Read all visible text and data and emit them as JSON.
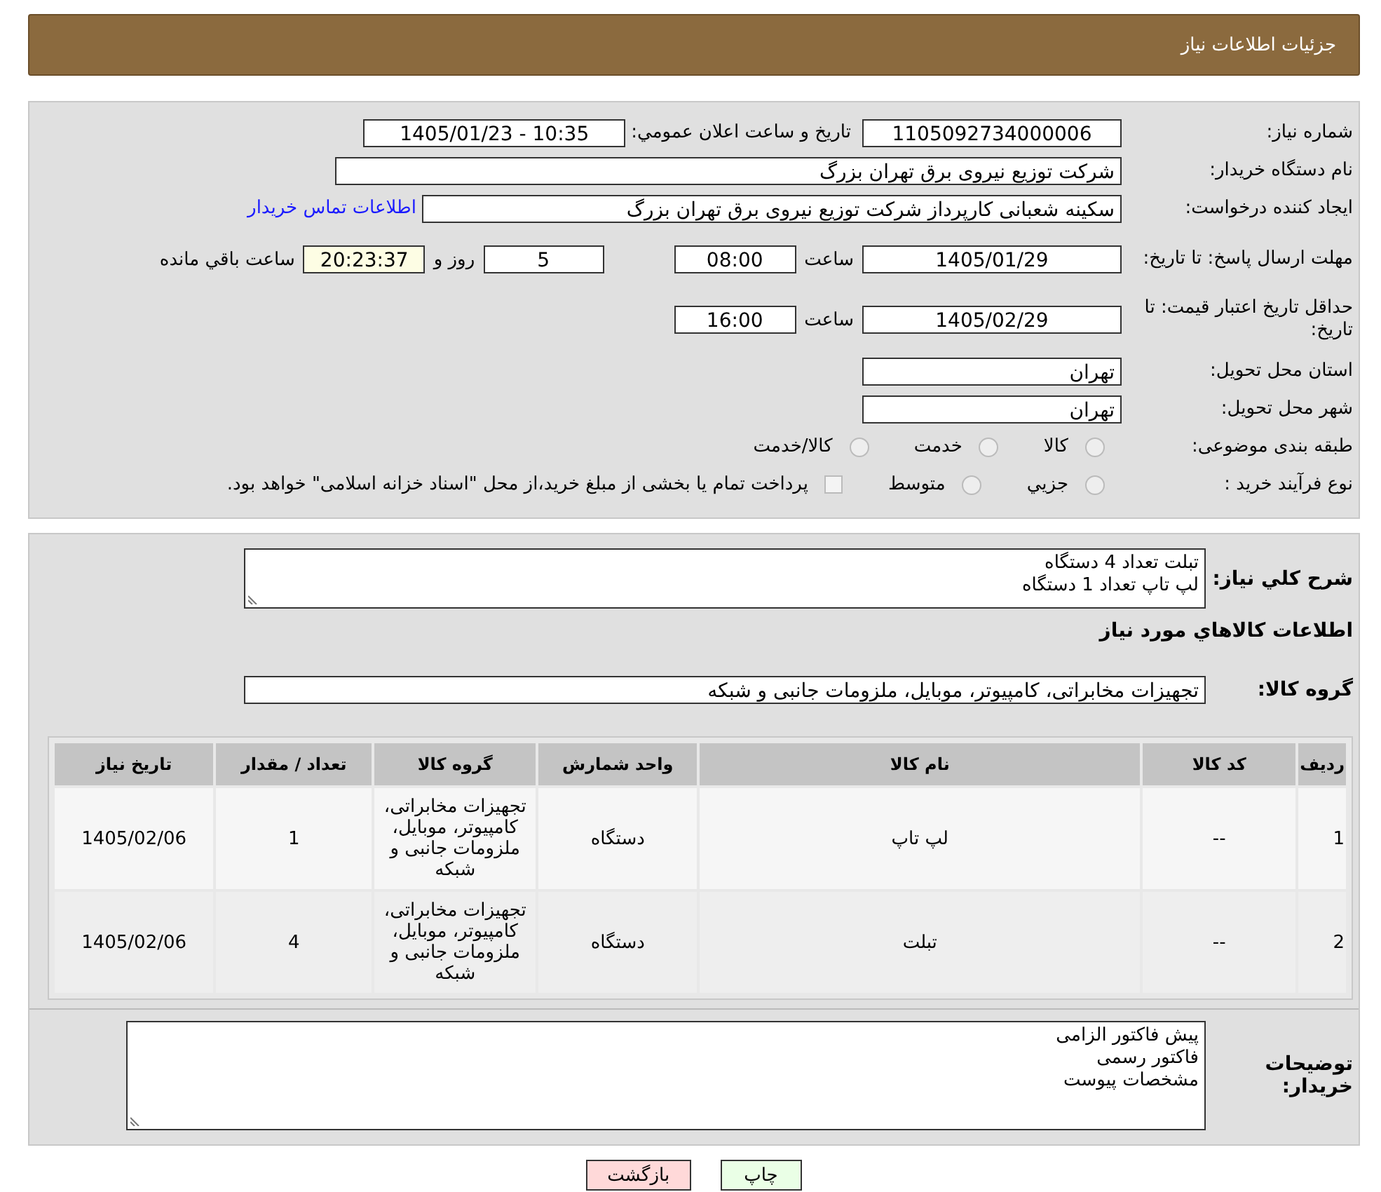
{
  "header": {
    "title": "جزئیات اطلاعات نیاز"
  },
  "details": {
    "need_number": {
      "label": "شماره نیاز:",
      "value": "1105092734000006"
    },
    "announce": {
      "label": "تاریخ و ساعت اعلان عمومي:",
      "value": "1405/01/23 - 10:35"
    },
    "buyer": {
      "label": "نام دستگاه خریدار:",
      "value": "شرکت توزیع نیروی برق تهران بزرگ"
    },
    "requester": {
      "label": "ایجاد کننده درخواست:",
      "value": "سکینه شعبانی کارپرداز شرکت توزیع نیروی برق تهران بزرگ",
      "link": "اطلاعات تماس خریدار"
    },
    "reply_deadline": {
      "label": "مهلت ارسال پاسخ: تا تاریخ:",
      "date": "1405/01/29",
      "time_label": "ساعت",
      "time": "08:00",
      "days": "5",
      "days_label": "روز و",
      "remaining": "20:23:37",
      "remaining_label": "ساعت باقي مانده"
    },
    "price_validity": {
      "label": "حداقل تاریخ اعتبار قیمت: تا تاریخ:",
      "date": "1405/02/29",
      "time_label": "ساعت",
      "time": "16:00"
    },
    "province": {
      "label": "استان محل تحویل:",
      "value": "تهران"
    },
    "city": {
      "label": "شهر محل تحویل:",
      "value": "تهران"
    },
    "category": {
      "label": "طبقه بندی موضوعی:",
      "options": [
        {
          "label": "کالا",
          "selected": false
        },
        {
          "label": "خدمت",
          "selected": false
        },
        {
          "label": "کالا/خدمت",
          "selected": false
        }
      ]
    },
    "process": {
      "label": "نوع فرآیند خرید :",
      "options": [
        {
          "label": "جزيي",
          "selected": false
        },
        {
          "label": "متوسط",
          "selected": false
        }
      ],
      "payment_note": {
        "checked": false,
        "text": "پرداخت تمام یا بخشی از مبلغ خرید،از محل \"اسناد خزانه اسلامی\" خواهد بود."
      }
    }
  },
  "summary": {
    "label": "شرح كلي نياز:",
    "lines": [
      "تبلت تعداد 4 دستگاه",
      "لپ تاپ تعداد 1 دستگاه"
    ]
  },
  "goods_heading": "اطلاعات كالاهاي مورد نياز",
  "goods_group": {
    "label": "گروه کالا:",
    "value": "تجهیزات مخابراتی، کامپیوتر، موبایل، ملزومات جانبی و شبکه"
  },
  "table": {
    "columns": [
      "ردیف",
      "کد کالا",
      "نام کالا",
      "واحد شمارش",
      "گروه کالا",
      "تعداد / مقدار",
      "تاریخ نیاز"
    ],
    "rows": [
      [
        "1",
        "--",
        "لپ تاپ",
        "دستگاه",
        "تجهیزات مخابراتی، کامپیوتر، موبایل، ملزومات جانبی و شبکه",
        "1",
        "1405/02/06"
      ],
      [
        "2",
        "--",
        "تبلت",
        "دستگاه",
        "تجهیزات مخابراتی، کامپیوتر، موبایل، ملزومات جانبی و شبکه",
        "4",
        "1405/02/06"
      ]
    ]
  },
  "buyer_notes": {
    "label": "توضیحات خریدار:",
    "lines": [
      "پیش فاکتور الزامی",
      "فاکتور رسمی",
      "مشخصات پیوست"
    ]
  },
  "buttons": [
    {
      "kind": "print",
      "label": "چاپ"
    },
    {
      "kind": "back",
      "label": "بازگشت"
    }
  ]
}
